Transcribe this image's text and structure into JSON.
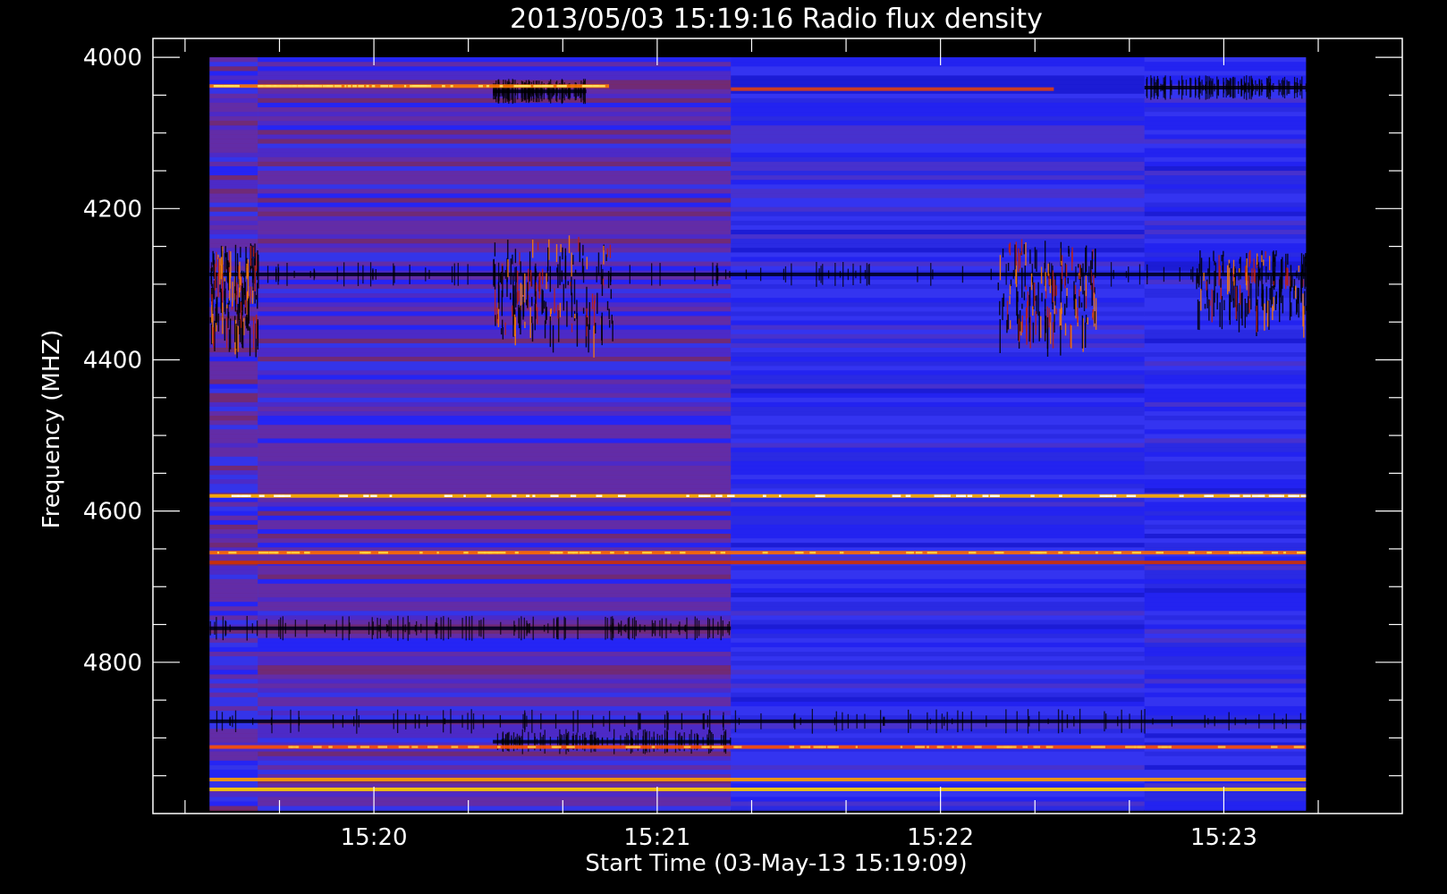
{
  "chart_data": {
    "type": "heatmap",
    "title": "2013/05/03 15:19:16 Radio flux density",
    "xlabel": "Start Time (03-May-13 15:19:09)",
    "ylabel": "Frequency (MHZ)",
    "x_tick_labels": [
      "15:20",
      "15:21",
      "15:22",
      "15:23"
    ],
    "y_tick_labels": [
      "4000",
      "4200",
      "4400",
      "4600",
      "4800"
    ],
    "x_range_minutes": [
      19.22,
      23.63
    ],
    "data_time_range_minutes": [
      19.42,
      23.29
    ],
    "y_range_mhz": [
      3975,
      5000
    ],
    "data_freq_range_mhz": [
      4000,
      4995
    ],
    "colormap": [
      "#000000",
      "#0000d8",
      "#2828ff",
      "#3c3cf0",
      "#8a2070",
      "#b4281e",
      "#ff6400",
      "#ffd200",
      "#ffffff"
    ],
    "background_color": "#3838f0",
    "time_segments_minutes": [
      {
        "t0": 19.42,
        "t1": 19.59,
        "tone": "reddish"
      },
      {
        "t0": 19.59,
        "t1": 21.26,
        "tone": "reddish"
      },
      {
        "t0": 21.26,
        "t1": 22.72,
        "tone": "blue"
      },
      {
        "t0": 22.72,
        "t1": 23.29,
        "tone": "blue"
      }
    ],
    "bright_lines": [
      {
        "mhz": 4038,
        "t0": 19.42,
        "t1": 20.83,
        "color": "#ff7a00",
        "core": "#ffe060"
      },
      {
        "mhz": 4042,
        "t0": 21.26,
        "t1": 22.4,
        "color": "#e04010",
        "core": null
      },
      {
        "mhz": 4580,
        "t0": 19.42,
        "t1": 23.29,
        "color": "#ffb000",
        "core": "#ffffff"
      },
      {
        "mhz": 4655,
        "t0": 19.42,
        "t1": 23.29,
        "color": "#ff6a00",
        "core": "#ffd040"
      },
      {
        "mhz": 4668,
        "t0": 19.42,
        "t1": 23.29,
        "color": "#d03000",
        "core": null
      },
      {
        "mhz": 4912,
        "t0": 19.42,
        "t1": 23.29,
        "color": "#ff5000",
        "core": "#ffc040"
      },
      {
        "mhz": 4955,
        "t0": 19.42,
        "t1": 23.29,
        "color": "#ffa000",
        "core": null
      },
      {
        "mhz": 4968,
        "t0": 19.42,
        "t1": 23.29,
        "color": "#ffd000",
        "core": null
      }
    ],
    "dark_bands": [
      {
        "mhz": 4045,
        "t0": 20.42,
        "t1": 20.75
      },
      {
        "mhz": 4040,
        "t0": 22.72,
        "t1": 23.29
      },
      {
        "mhz": 4287,
        "t0": 19.42,
        "t1": 23.29
      },
      {
        "mhz": 4755,
        "t0": 19.42,
        "t1": 21.26
      },
      {
        "mhz": 4878,
        "t0": 19.42,
        "t1": 23.29
      },
      {
        "mhz": 4905,
        "t0": 20.42,
        "t1": 21.26
      }
    ],
    "burst_regions": [
      {
        "t0": 20.42,
        "t1": 20.85,
        "f0": 4235,
        "f1": 4360
      },
      {
        "t0": 22.2,
        "t1": 22.55,
        "f0": 4240,
        "f1": 4355
      },
      {
        "t0": 19.42,
        "t1": 19.59,
        "f0": 4245,
        "f1": 4360
      },
      {
        "t0": 22.9,
        "t1": 23.29,
        "f0": 4255,
        "f1": 4330
      }
    ]
  }
}
